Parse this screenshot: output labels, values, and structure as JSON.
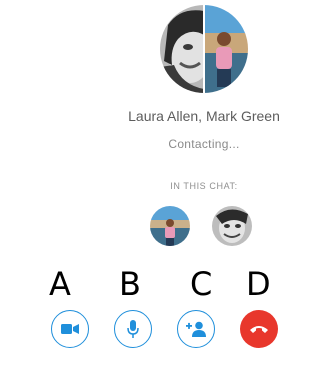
{
  "call": {
    "participants_label": "Laura Allen, Mark Green",
    "status": "Contacting...",
    "in_this_chat_label": "IN THIS CHAT:"
  },
  "participants": [
    {
      "name": "Laura Allen",
      "avatar": "photo"
    },
    {
      "name": "Mark Green",
      "avatar": "photo"
    }
  ],
  "annotations": [
    "A",
    "B",
    "C",
    "D"
  ],
  "controls": [
    {
      "id": "video",
      "icon": "video-camera-icon"
    },
    {
      "id": "mic",
      "icon": "microphone-icon"
    },
    {
      "id": "add-people",
      "icon": "add-person-icon"
    },
    {
      "id": "end-call",
      "icon": "phone-hangup-icon"
    }
  ],
  "colors": {
    "accent": "#1f8fdb",
    "end_call": "#e8372c",
    "text_primary": "#5d5d5d",
    "text_secondary": "#8a8a8a"
  }
}
